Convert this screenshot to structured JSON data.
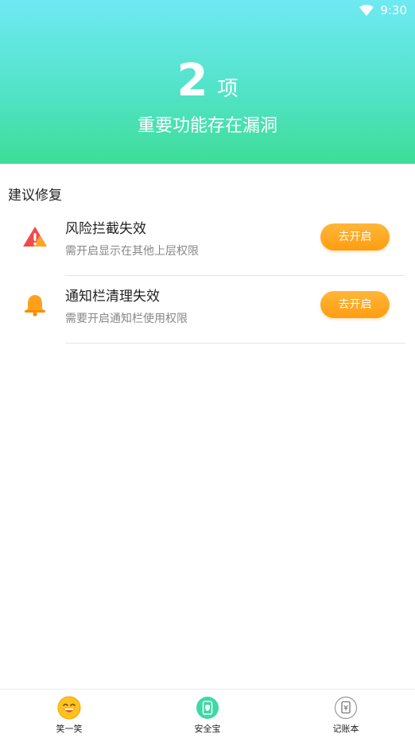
{
  "status": {
    "time": "9:30"
  },
  "header": {
    "count": "2",
    "unit": "项",
    "subtitle": "重要功能存在漏洞"
  },
  "section": {
    "title": "建议修复"
  },
  "items": [
    {
      "title": "风险拦截失效",
      "desc": "需开启显示在其他上层权限",
      "button": "去开启",
      "icon": "warning-triangle-icon"
    },
    {
      "title": "通知栏清理失效",
      "desc": "需要开启通知栏使用权限",
      "button": "去开启",
      "icon": "bell-icon"
    }
  ],
  "tabs": [
    {
      "label": "笑一笑",
      "icon": "smiley-icon"
    },
    {
      "label": "安全宝",
      "icon": "phone-shield-icon"
    },
    {
      "label": "记账本",
      "icon": "ledger-icon"
    }
  ],
  "colors": {
    "accent": "#ff9d10",
    "header_top": "#6fe9f3",
    "header_bottom": "#3edd98"
  }
}
